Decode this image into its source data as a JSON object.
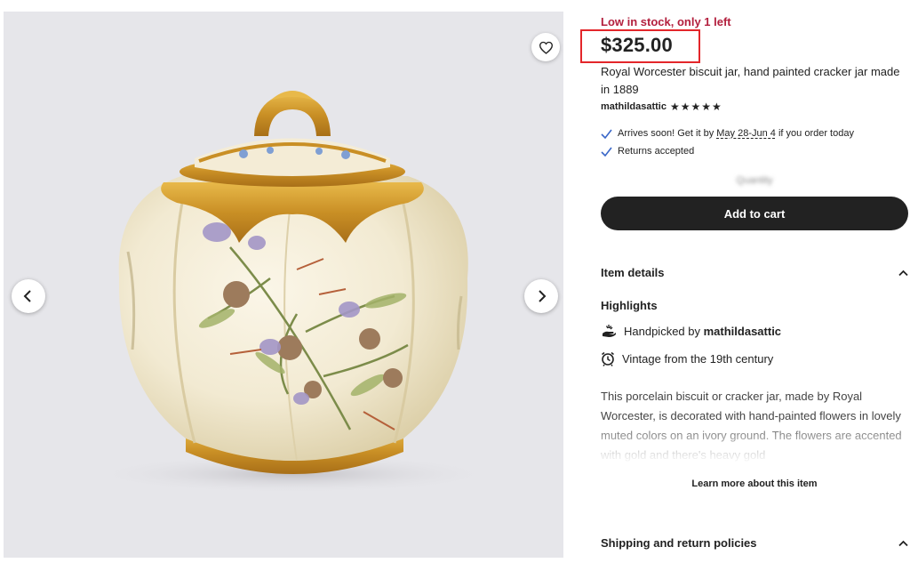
{
  "gallery": {
    "favorite_icon": "heart-outline-icon",
    "prev_icon": "chevron-left-icon",
    "next_icon": "chevron-right-icon",
    "image_subject": "biscuit-jar-photo"
  },
  "listing": {
    "stock_notice": "Low in stock, only 1 left",
    "price": "$325.00",
    "title": "Royal Worcester biscuit jar, hand painted cracker jar made in 1889",
    "shop_name": "mathildasattic",
    "rating_stars": 5
  },
  "shipping": {
    "arrival_prefix": "Arrives soon! Get it by ",
    "arrival_dates": "May 28-Jun 4",
    "arrival_suffix": " if you order today",
    "returns": "Returns accepted",
    "check_icon": "check-icon"
  },
  "purchase": {
    "quantity_hint": "Quantity",
    "add_to_cart": "Add to cart"
  },
  "details": {
    "section_title": "Item details",
    "highlights_title": "Highlights",
    "handpicked_prefix": "Handpicked by ",
    "handpicked_by": "mathildasattic",
    "vintage": "Vintage from the 19th century",
    "description": "This porcelain biscuit or cracker jar, made by Royal Worcester, is decorated with hand-painted flowers in lovely muted colors on an ivory ground. The flowers are accented with gold and there's heavy gold",
    "learn_more": "Learn more about this item"
  },
  "policies": {
    "section_title": "Shipping and return policies"
  },
  "colors": {
    "stock_red": "#b3203e",
    "highlight_box": "#e3262a",
    "cart_button": "#222222",
    "link_check": "#3a67c8"
  }
}
